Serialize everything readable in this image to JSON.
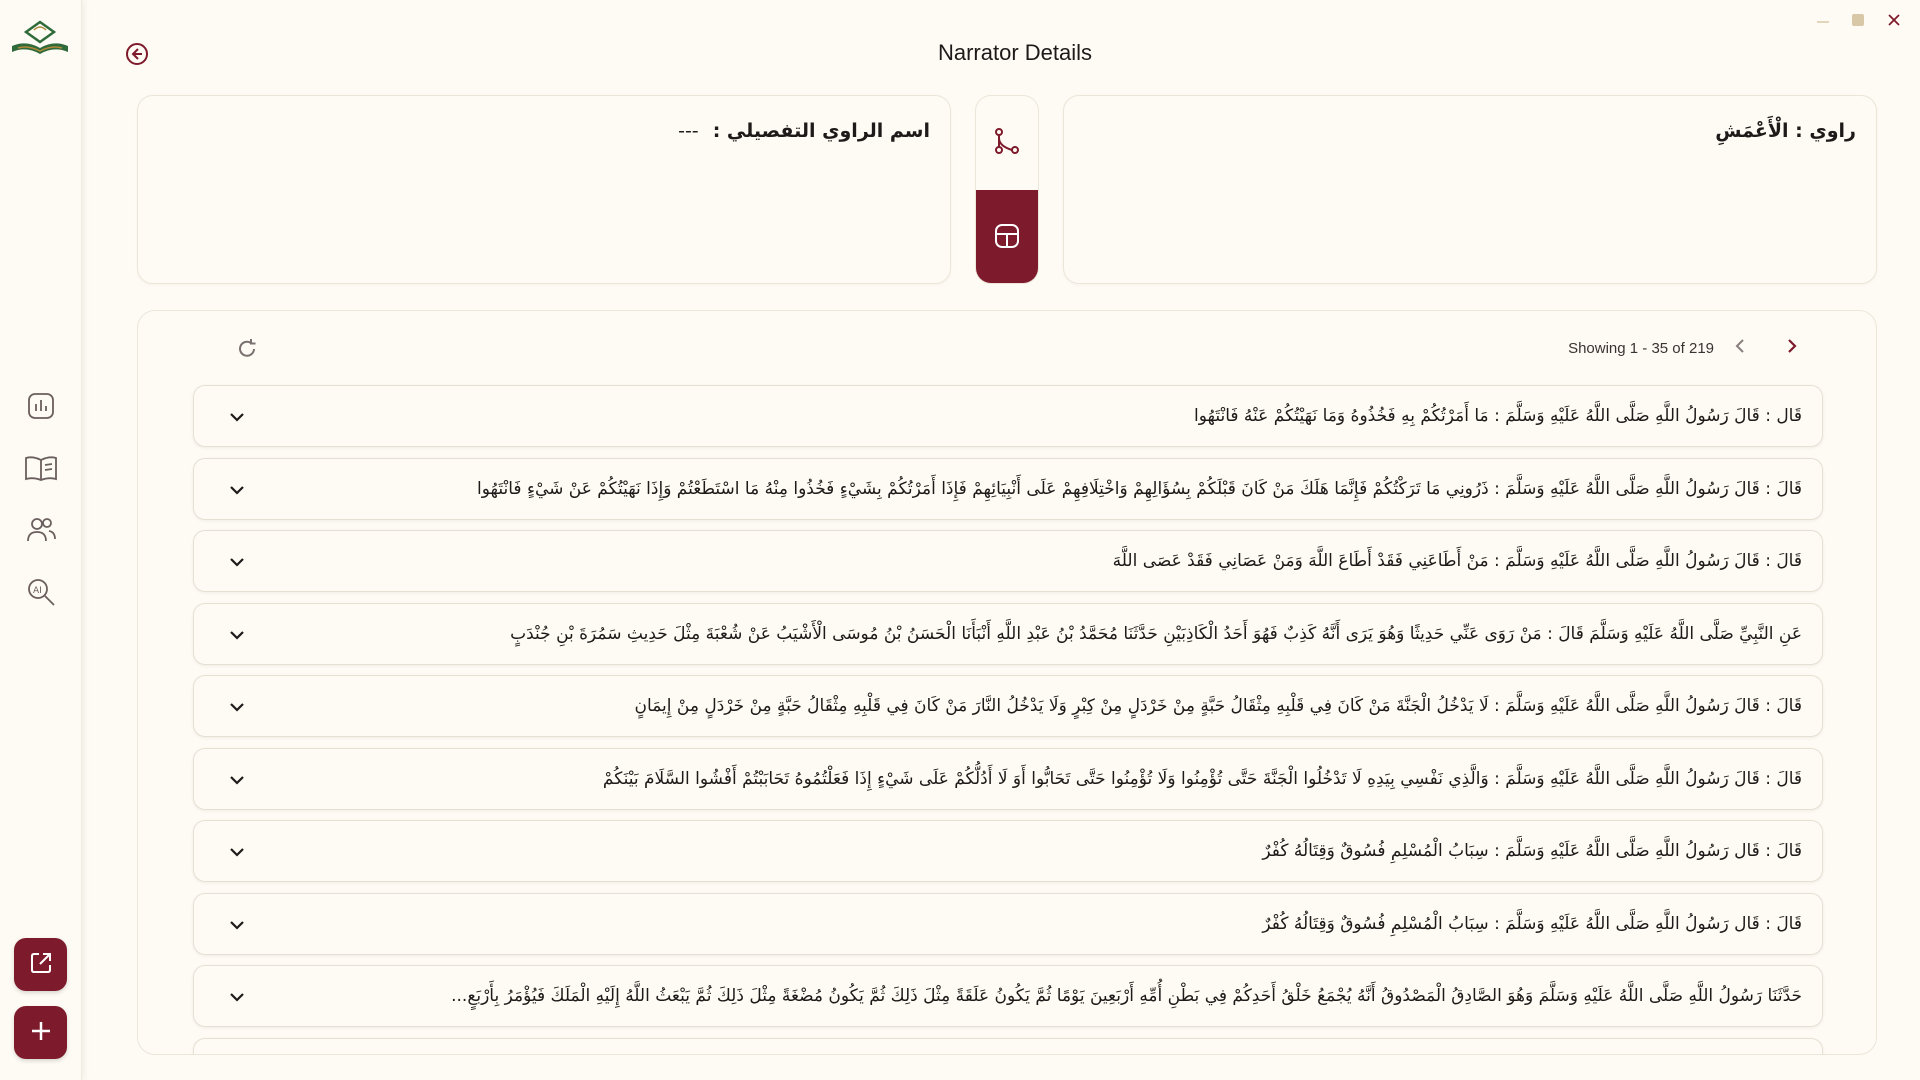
{
  "window": {
    "title": "Narrator Details"
  },
  "window_controls": {
    "minimize": "—",
    "close": "✕"
  },
  "sidebar": {
    "items": [
      {
        "name": "stats",
        "icon": "bar-chart-icon"
      },
      {
        "name": "books",
        "icon": "book-icon"
      },
      {
        "name": "narrators",
        "icon": "users-icon"
      },
      {
        "name": "ai-search",
        "icon": "ai-search-icon"
      }
    ],
    "actions": [
      {
        "name": "open-external",
        "icon": "external-link-icon"
      },
      {
        "name": "add",
        "icon": "plus-icon"
      }
    ]
  },
  "detail_card": {
    "label": "اسم الراوي التفصيلي :",
    "value": "---"
  },
  "narrator_card": {
    "text": "راوي : الْأَعْمَشِ"
  },
  "pagination": {
    "text": "Showing 1 - 35 of 219"
  },
  "hadith_list": [
    "قَال : قَالَ رَسُولُ اللَّهِ صَلَّى اللَّهُ عَلَيْهِ وَسَلَّمَ : مَا أَمَرْتُكُمْ بِهِ فَخُذُوهُ وَمَا نَهَيْتُكُمْ عَنْهُ فَانْتَهُوا",
    "قَالَ : قَالَ رَسُولُ اللَّهِ صَلَّى اللَّهُ عَلَيْهِ وَسَلَّمَ : ذَرُونِي مَا تَرَكْتُكُمْ فَإِنَّمَا هَلَكَ مَنْ كَانَ قَبْلَكُمْ بِسُؤَالِهِمْ وَاخْتِلَافِهِمْ عَلَى أَنْبِيَائِهِمْ فَإِذَا أَمَرْتُكُمْ بِشَيْءٍ فَخُذُوا مِنْهُ مَا اسْتَطَعْتُمْ وَإِذَا نَهَيْتُكُمْ عَنْ شَيْءٍ فَانْتَهُوا",
    "قَالَ : قَالَ رَسُولُ اللَّهِ صَلَّى اللَّهُ عَلَيْهِ وَسَلَّمَ : مَنْ أَطَاعَنِي فَقَدْ أَطَاعَ اللَّهَ وَمَنْ عَصَانِي فَقَدْ عَصَى اللَّهَ",
    "عَنِ النَّبِيِّ صَلَّى اللَّهُ عَلَيْهِ وَسَلَّمَ قَالَ : مَنْ رَوَى عَنِّي حَدِيثًا وَهُوَ يَرَى أَنَّهُ كَذِبٌ فَهُوَ أَحَدُ الْكَاذِبَيْنِ حَدَّثَنَا مُحَمَّدُ بْنُ عَبْدِ اللَّهِ أَنْبَأَنَا الْحَسَنُ بْنُ مُوسَى الْأَشْيَبُ عَنْ شُعْبَةَ مِثْلَ حَدِيثِ سَمُرَةَ بْنِ جُنْدَبٍ",
    "قَالَ : قَالَ رَسُولُ اللَّهِ صَلَّى اللَّهُ عَلَيْهِ وَسَلَّمَ : لَا يَدْخُلُ الْجَنَّةَ مَنْ كَانَ فِي قَلْبِهِ مِثْقَالُ حَبَّةٍ مِنْ خَرْدَلٍ مِنْ كِبْرٍ وَلَا يَدْخُلُ النَّارَ مَنْ كَانَ فِي قَلْبِهِ مِثْقَالُ حَبَّةٍ مِنْ خَرْدَلٍ مِنْ إِيمَانٍ",
    "قَالَ : قَالَ رَسُولُ اللَّهِ صَلَّى اللَّهُ عَلَيْهِ وَسَلَّمَ : وَالَّذِي نَفْسِي بِيَدِهِ لَا تَدْخُلُوا الْجَنَّةَ حَتَّى تُؤْمِنُوا وَلَا تُؤْمِنُوا حَتَّى تَحَابُّوا أَوَ لَا أَدُلُّكُمْ عَلَى شَيْءٍ إِذَا فَعَلْتُمُوهُ تَحَابَبْتُمْ أَفْشُوا السَّلَامَ بَيْنَكُمْ",
    "قَالَ : قَال رَسُولُ اللَّهِ صَلَّى اللَّهُ عَلَيْهِ وَسَلَّمَ : سِبَابُ الْمُسْلِمِ فُسُوقٌ وَقِتَالُهُ كُفْرٌ",
    "قَالَ : قَال رَسُولُ اللَّهِ صَلَّى اللَّهُ عَلَيْهِ وَسَلَّمَ : سِبَابُ الْمُسْلِمِ فُسُوقٌ وَقِتَالُهُ كُفْرٌ",
    "حَدَّثَنَا رَسُولُ اللَّهِ صَلَّى اللَّهُ عَلَيْهِ وَسَلَّمَ وَهُوَ الصَّادِقُ الْمَصْدُوقُ أَنَّهُ يُجْمَعُ خَلْقُ أَحَدِكُمْ فِي بَطْنِ أُمِّهِ أَرْبَعِينَ يَوْمًا ثُمَّ يَكُونُ عَلَقَةً مِثْلَ ذَلِكَ ثُمَّ يَكُونُ مُضْغَةً مِثْلَ ذَلِكَ ثُمَّ يَبْعَثُ اللَّهُ إِلَيْهِ الْمَلَكَ فَيُؤْمَرُ بِأَرْبَعٍ..."
  ],
  "colors": {
    "accent": "#7d1a2c",
    "background": "#fdfbf3",
    "icon": "#5a4a4a"
  }
}
